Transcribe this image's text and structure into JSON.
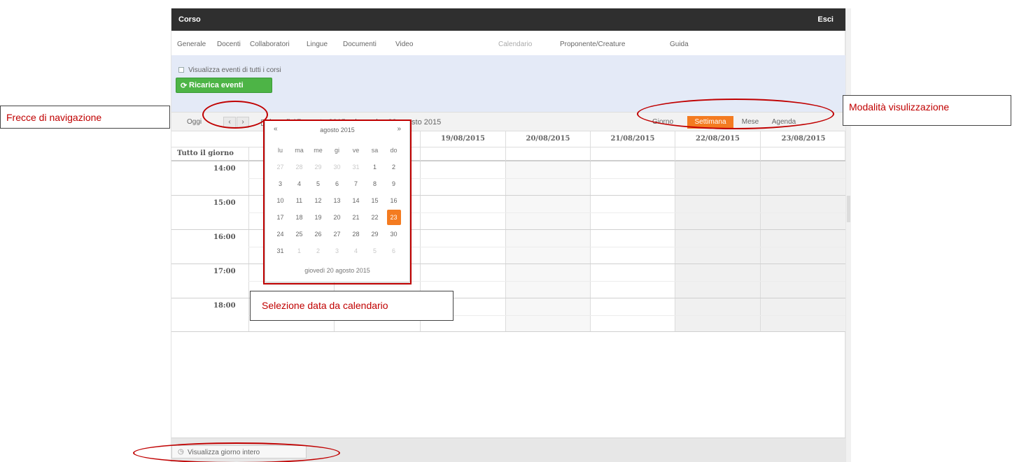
{
  "window": {
    "title": "Corso",
    "exit_label": "Esci"
  },
  "tabs": [
    {
      "label": "Generale"
    },
    {
      "label": "Docenti"
    },
    {
      "label": "Collaboratori"
    },
    {
      "label": "Lingue"
    },
    {
      "label": "Documenti"
    },
    {
      "label": "Video"
    },
    {
      "label": "Calendario"
    },
    {
      "label": "Proponente/Creature"
    },
    {
      "label": "Guida"
    }
  ],
  "active_tab": "Calendario",
  "filter": {
    "show_all_events_label": "Visualizza eventi di tutti i corsi",
    "show_all_events_checked": false,
    "reload_label": "Ricarica eventi"
  },
  "toolbar": {
    "today_label": "Oggi",
    "prev_icon": "chevron-left-icon",
    "next_icon": "chevron-right-icon",
    "prev_glyph": "‹",
    "next_glyph": "›",
    "range_label": "lunedì 17 agosto 2015 - domenica 23 agosto 2015",
    "views": [
      {
        "label": "Giorno",
        "active": false
      },
      {
        "label": "Settimana",
        "active": true
      },
      {
        "label": "Mese",
        "active": false
      },
      {
        "label": "Agenda",
        "active": false
      }
    ]
  },
  "calendar": {
    "columns": [
      "19/08/2015",
      "20/08/2015",
      "21/08/2015",
      "22/08/2015",
      "23/08/2015"
    ],
    "all_day_label": "Tutto il giorno",
    "hours": [
      "14:00",
      "15:00",
      "16:00",
      "17:00",
      "18:00"
    ]
  },
  "datepicker": {
    "month_label": "agosto 2015",
    "prev_glyph": "«",
    "next_glyph": "»",
    "weekdays": [
      "lu",
      "ma",
      "me",
      "gi",
      "ve",
      "sa",
      "do"
    ],
    "weeks": [
      [
        "27",
        "28",
        "29",
        "30",
        "31",
        "1",
        "2"
      ],
      [
        "3",
        "4",
        "5",
        "6",
        "7",
        "8",
        "9"
      ],
      [
        "10",
        "11",
        "12",
        "13",
        "14",
        "15",
        "16"
      ],
      [
        "17",
        "18",
        "19",
        "20",
        "21",
        "22",
        "23"
      ],
      [
        "24",
        "25",
        "26",
        "27",
        "28",
        "29",
        "30"
      ],
      [
        "31",
        "1",
        "2",
        "3",
        "4",
        "5",
        "6"
      ]
    ],
    "selected_day": "23",
    "today_label": "giovedì 20 agosto 2015"
  },
  "footer": {
    "full_day_label": "Visualizza giorno intero"
  },
  "annotations": {
    "nav_arrows": "Frecce di navigazione",
    "view_modes": "Modalità visulizzazione",
    "date_select": "Selezione data da calendario"
  },
  "colors": {
    "accent_orange": "#f47b20",
    "reload_green": "#4db446",
    "annotation_red": "#c00000",
    "titlebar_dark": "#2f2f2f",
    "filter_panel_blue": "#e4eaf7"
  }
}
